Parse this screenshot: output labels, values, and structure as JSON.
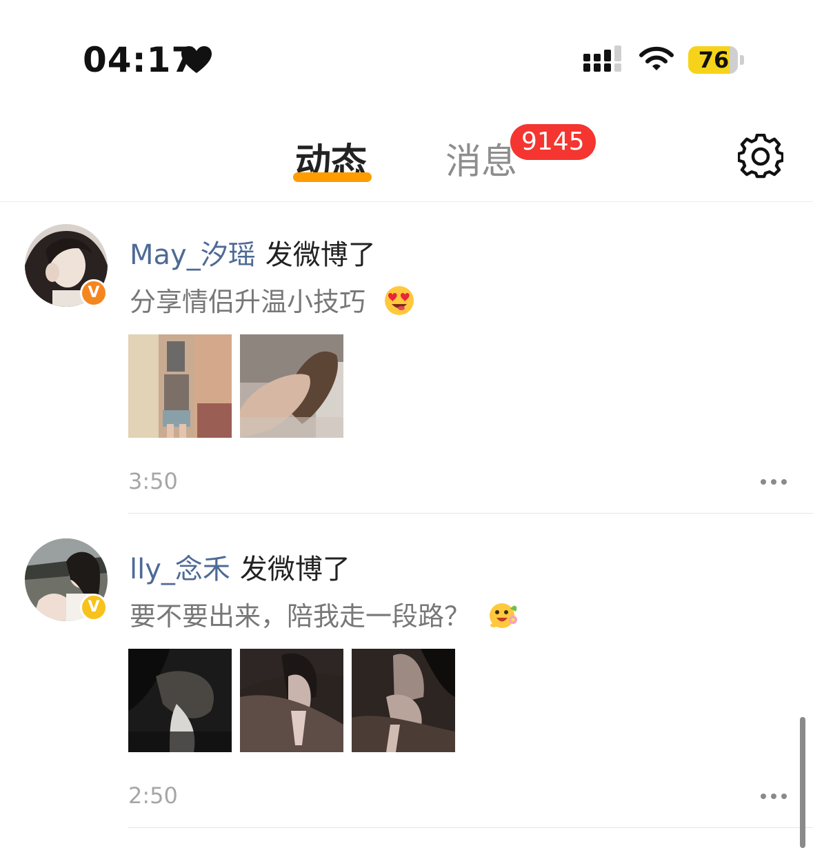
{
  "status_bar": {
    "time": "04:17",
    "battery": "76",
    "icons": [
      "heart-icon",
      "signal-icon",
      "wifi-icon",
      "battery-icon"
    ]
  },
  "header": {
    "tabs": [
      {
        "label": "动态",
        "active": true
      },
      {
        "label": "消息",
        "badge": "9145"
      }
    ],
    "settings_icon": "gear-icon",
    "accent_color": "#ff9c00",
    "badge_color": "#f43530"
  },
  "feed": [
    {
      "username": "May_汐瑶",
      "action": "发微博了",
      "text": "分享情侣升温小技巧",
      "emoji": "heart-eyes-emoji",
      "verified_color": "#f5861f",
      "image_count": 2,
      "time": "3:50"
    },
    {
      "username": "lly_念禾",
      "action": "发微博了",
      "text": "要不要出来，陪我走一段路？",
      "emoji": "flower-face-emoji",
      "verified_color": "#f7c21c",
      "image_count": 3,
      "time": "2:50"
    }
  ],
  "verified_mark": "V"
}
